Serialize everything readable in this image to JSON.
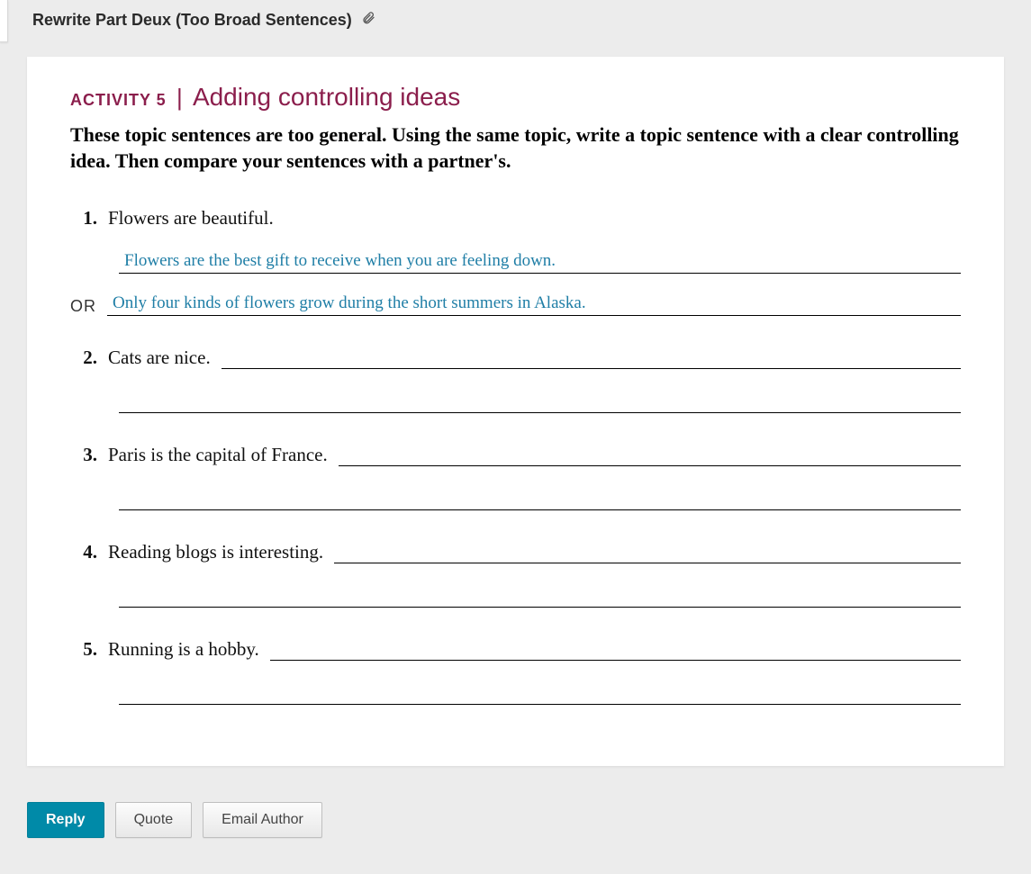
{
  "header": {
    "title": "Rewrite Part Deux (Too Broad Sentences)"
  },
  "activity": {
    "label": "ACTIVITY 5",
    "pipe": "|",
    "subtitle": "Adding controlling ideas",
    "instructions": "These topic sentences are too general. Using the same topic, write a topic sentence with a clear controlling idea. Then compare your sentences with a partner's."
  },
  "items": [
    {
      "num": "1.",
      "prompt": "Flowers are beautiful.",
      "answer1": "Flowers are the best gift to receive when you are feeling down.",
      "or_label": "OR",
      "answer2": "Only four kinds of flowers grow during the short summers in Alaska."
    },
    {
      "num": "2.",
      "prompt": "Cats are nice."
    },
    {
      "num": "3.",
      "prompt": "Paris is the capital of France."
    },
    {
      "num": "4.",
      "prompt": "Reading blogs is interesting."
    },
    {
      "num": "5.",
      "prompt": "Running is a hobby."
    }
  ],
  "buttons": {
    "reply": "Reply",
    "quote": "Quote",
    "email_author": "Email Author"
  }
}
